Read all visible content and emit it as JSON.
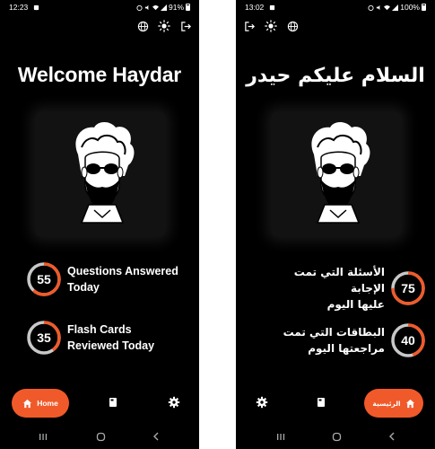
{
  "left": {
    "status": {
      "time": "12:23",
      "battery": "91%"
    },
    "welcome": "Welcome Haydar",
    "stats": [
      {
        "value": "55",
        "label_line1": "Questions Answered",
        "label_line2": "Today",
        "fraction": 0.62
      },
      {
        "value": "35",
        "label_line1": "Flash Cards",
        "label_line2": "Reviewed Today",
        "fraction": 0.4
      }
    ],
    "nav": {
      "home_label": "Home"
    }
  },
  "right": {
    "status": {
      "time": "13:02",
      "battery": "100%"
    },
    "welcome": "السلام عليكم حيدر",
    "stats": [
      {
        "value": "75",
        "label_line1": "الأسئلة التي تمت الإجابة",
        "label_line2": "عليها اليوم",
        "fraction": 0.75
      },
      {
        "value": "40",
        "label_line1": "البطاقات التي تمت",
        "label_line2": "مراجعتها اليوم",
        "fraction": 0.45
      }
    ],
    "nav": {
      "home_label": "الرئيسية"
    }
  },
  "colors": {
    "accent": "#f05a2a",
    "ring_track": "#c8c8c8",
    "background": "#000000"
  },
  "icons": [
    "globe-icon",
    "brightness-icon",
    "logout-icon",
    "home-icon",
    "cards-icon",
    "settings-icon",
    "recent-apps-icon",
    "system-home-icon",
    "back-icon"
  ]
}
